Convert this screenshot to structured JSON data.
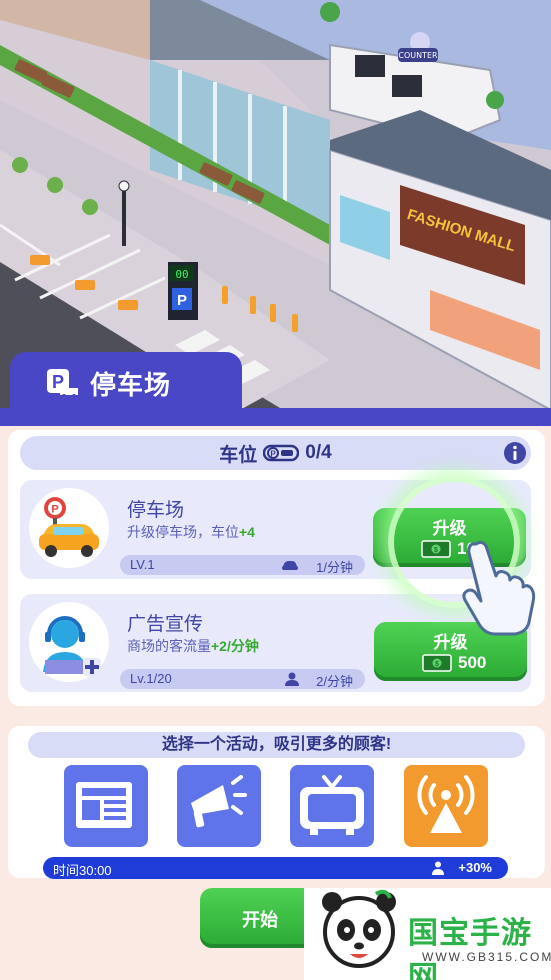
{
  "scene": {
    "store_sign": "FASHION MALL",
    "counter_sign": "COUNTER",
    "parking_meter_text": "00",
    "parking_sign": "P"
  },
  "panel": {
    "title": "停车场"
  },
  "slots": {
    "label": "车位",
    "value": "0/4"
  },
  "upgrades": [
    {
      "title": "停车场",
      "desc_prefix": "升级停车场，车位",
      "desc_bonus": "+4",
      "desc_suffix": "",
      "level": "LV.1",
      "rate": "1/分钟",
      "button_label": "升级",
      "price": "100"
    },
    {
      "title": "广告宣传",
      "desc_prefix": "商场的客流量",
      "desc_bonus": "+2/分钟",
      "desc_suffix": "",
      "level": "Lv.1/20",
      "rate": "2/分钟",
      "button_label": "升级",
      "price": "500"
    }
  ],
  "activities": {
    "prompt": "选择一个活动，吸引更多的顾客!",
    "items": [
      "newspaper-icon",
      "megaphone-icon",
      "tv-icon",
      "radio-tower-icon"
    ],
    "time": "时间30:00",
    "bonus": "+30%",
    "start_label": "开始"
  },
  "watermark": {
    "logo": "国宝手游网",
    "url": "WWW.GB315.COM"
  },
  "colors": {
    "panel": "#4a47c6",
    "button_green": "#2aa934",
    "activity_blue": "#5f74e8",
    "activity_orange": "#f29a2e",
    "time_bar": "#1f3bd8"
  }
}
